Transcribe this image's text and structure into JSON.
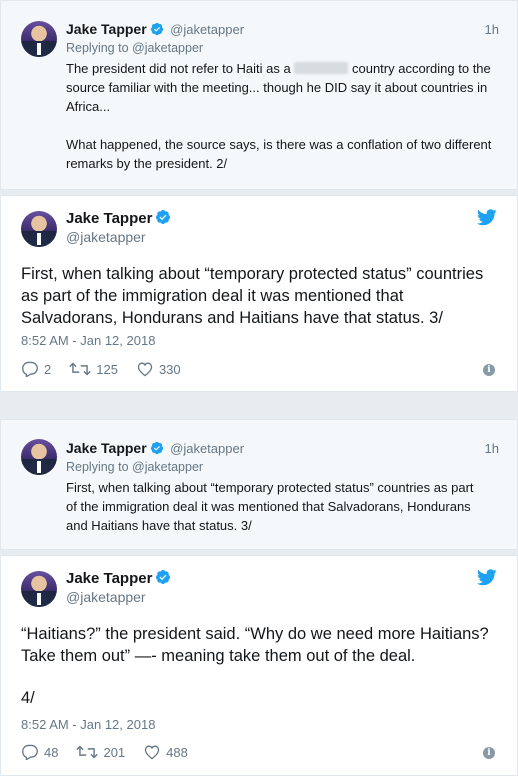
{
  "tweets": [
    {
      "kind": "reply",
      "name": "Jake Tapper",
      "handle": "@jaketapper",
      "time": "1h",
      "replying_to": "Replying to @jaketapper",
      "text_line1_pre": "The president did not refer to Haiti as a",
      "text_line1_post": "country according to",
      "text_rest": "the source familiar with the meeting... though he DID say it about countries in Africa...",
      "text_para2": "What happened, the source says, is there was a conflation of two different remarks by the president. 2/"
    },
    {
      "kind": "main",
      "name": "Jake Tapper",
      "handle": "@jaketapper",
      "text": "First, when talking about “temporary protected status” countries as part of the immigration deal it was mentioned that Salvadorans, Hondurans and Haitians have that status. 3/",
      "timestamp": "8:52 AM - Jan 12, 2018",
      "replies": "2",
      "retweets": "125",
      "likes": "330"
    },
    {
      "kind": "reply",
      "name": "Jake Tapper",
      "handle": "@jaketapper",
      "time": "1h",
      "replying_to": "Replying to @jaketapper",
      "text": "First, when talking about “temporary protected status” countries as part of the immigration deal it was mentioned that Salvadorans, Hondurans and Haitians have that status. 3/"
    },
    {
      "kind": "main",
      "name": "Jake Tapper",
      "handle": "@jaketapper",
      "text": "“Haitians?” the president said. “Why do we need more Haitians? Take them out” —- meaning take them out of the deal.",
      "text_para2": "4/",
      "timestamp": "8:52 AM - Jan 12, 2018",
      "replies": "48",
      "retweets": "201",
      "likes": "488"
    }
  ],
  "icons": {
    "verified": "verified-badge-icon",
    "bird": "twitter-bird-icon",
    "reply": "reply-icon",
    "retweet": "retweet-icon",
    "like": "heart-icon",
    "info": "info-icon"
  },
  "colors": {
    "accent": "#1da1f2",
    "muted": "#657786",
    "reply_bg": "#f5f8fa"
  }
}
